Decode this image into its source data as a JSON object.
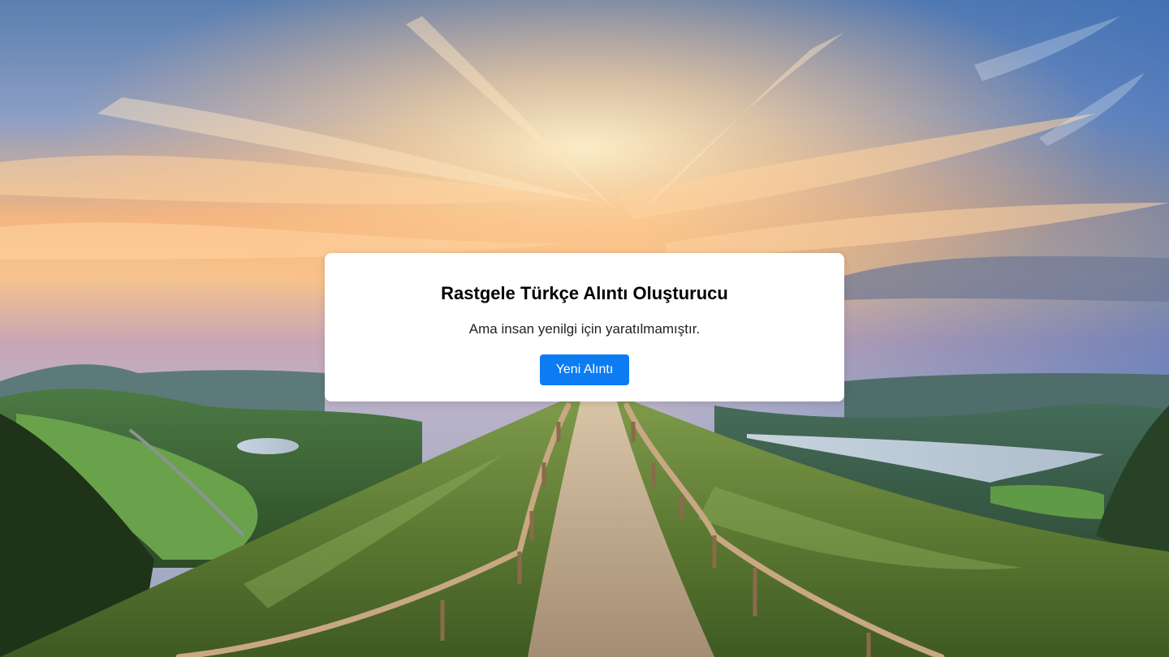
{
  "card": {
    "title": "Rastgele Türkçe Alıntı Oluşturucu",
    "quote": "Ama insan yenilgi için yaratılmamıştır.",
    "button_label": "Yeni Alıntı"
  },
  "colors": {
    "button": "#0d7cf2",
    "card_background": "#ffffff",
    "title_text": "#000000"
  }
}
